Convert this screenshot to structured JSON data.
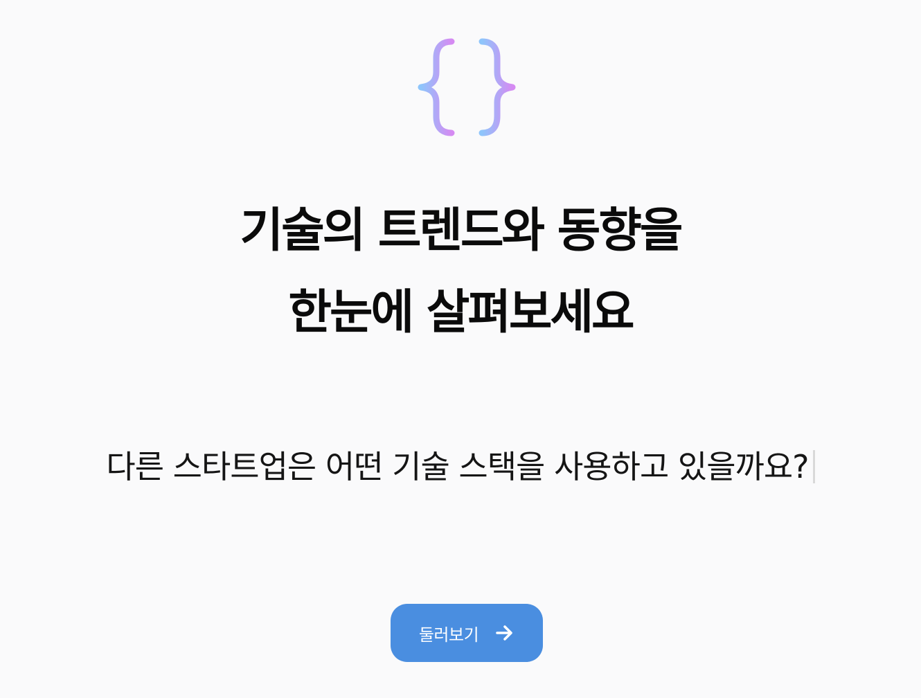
{
  "logo": {
    "icon": "curly-braces-logo",
    "gradient_start": "#8ec5fb",
    "gradient_end": "#d58af2"
  },
  "hero": {
    "headline_line1": "기술의 트렌드와 동향을",
    "headline_line2": "한눈에 살펴보세요",
    "subtitle": "다른 스타트업은 어떤 기술 스택을 사용하고 있을까요?"
  },
  "cta": {
    "label": "둘러보기",
    "icon": "arrow-right-icon",
    "background": "#4a8ee0"
  }
}
